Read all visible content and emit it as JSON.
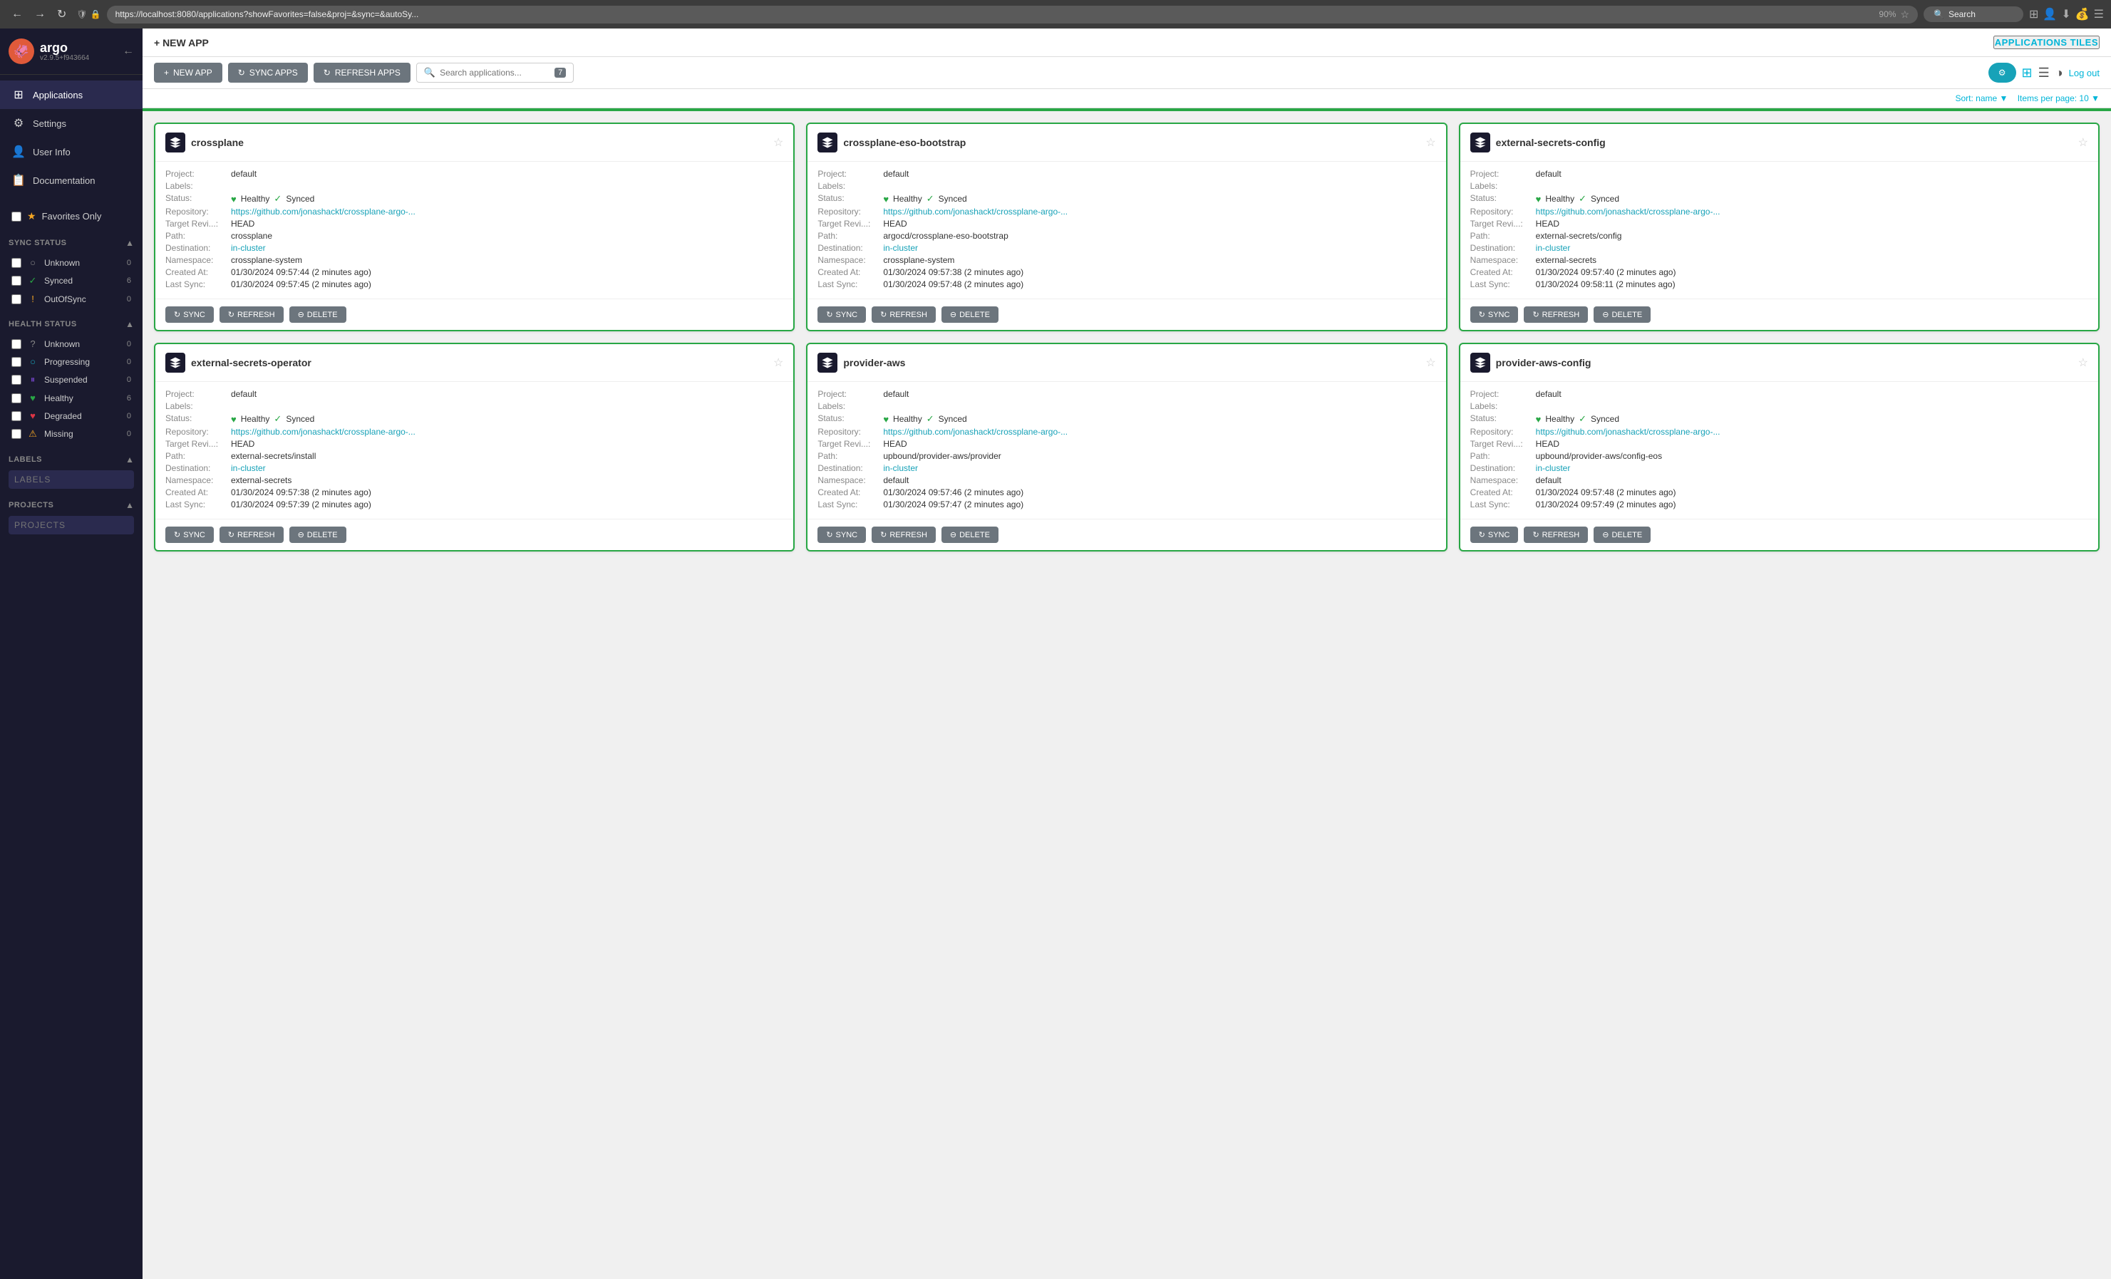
{
  "browser": {
    "url": "https://localhost:8080/applications?showFavorites=false&proj=&sync=&autoSy...",
    "zoom": "90%",
    "search_placeholder": "Search"
  },
  "sidebar": {
    "logo": {
      "name": "argo",
      "version": "v2.9.5+f943664"
    },
    "nav_items": [
      {
        "id": "applications",
        "label": "Applications",
        "icon": "⊞"
      },
      {
        "id": "settings",
        "label": "Settings",
        "icon": "⚙"
      },
      {
        "id": "user-info",
        "label": "User Info",
        "icon": "👤"
      },
      {
        "id": "documentation",
        "label": "Documentation",
        "icon": "📋"
      }
    ],
    "filters": {
      "favorites": {
        "label": "Favorites Only",
        "checked": false
      },
      "sync_status": {
        "title": "SYNC STATUS",
        "items": [
          {
            "id": "unknown",
            "label": "Unknown",
            "icon": "○",
            "color": "#888",
            "count": 0
          },
          {
            "id": "synced",
            "label": "Synced",
            "icon": "✓",
            "color": "#28a745",
            "count": 6
          },
          {
            "id": "out-of-sync",
            "label": "OutOfSync",
            "icon": "!",
            "color": "#f5a623",
            "count": 0
          }
        ]
      },
      "health_status": {
        "title": "HEALTH STATUS",
        "items": [
          {
            "id": "unknown-health",
            "label": "Unknown",
            "icon": "?",
            "color": "#888",
            "count": 0
          },
          {
            "id": "progressing",
            "label": "Progressing",
            "icon": "○",
            "color": "#17a2b8",
            "count": 0
          },
          {
            "id": "suspended",
            "label": "Suspended",
            "icon": "⏸",
            "color": "#6f42c1",
            "count": 0
          },
          {
            "id": "healthy",
            "label": "Healthy",
            "icon": "♥",
            "color": "#28a745",
            "count": 6
          },
          {
            "id": "degraded",
            "label": "Degraded",
            "icon": "♥",
            "color": "#dc3545",
            "count": 0
          },
          {
            "id": "missing",
            "label": "Missing",
            "icon": "⚠",
            "color": "#f5a623",
            "count": 0
          }
        ]
      },
      "labels": {
        "title": "LABELS",
        "placeholder": "LABELS"
      },
      "projects": {
        "title": "PROJECTS",
        "placeholder": "PROJECTS"
      }
    }
  },
  "toolbar": {
    "new_app_label": "+ NEW APP",
    "sync_apps_label": "↻ SYNC APPS",
    "refresh_apps_label": "↻ REFRESH APPS",
    "search_placeholder": "Search applications...",
    "search_count": "7",
    "app_tiles_label": "APPLICATIONS TILES",
    "logout_label": "Log out",
    "sort_label": "Sort: name",
    "items_per_page_label": "Items per page: 10"
  },
  "apps": [
    {
      "id": "crossplane",
      "name": "crossplane",
      "project": "default",
      "labels": "",
      "health": "Healthy",
      "sync": "Synced",
      "repository": "https://github.com/jonashackt/crossplane-argo-...",
      "target_revision": "HEAD",
      "path": "crossplane",
      "destination": "in-cluster",
      "namespace": "crossplane-system",
      "created_at": "01/30/2024 09:57:44 (2 minutes ago)",
      "last_sync": "01/30/2024 09:57:45 (2 minutes ago)"
    },
    {
      "id": "crossplane-eso-bootstrap",
      "name": "crossplane-eso-bootstrap",
      "project": "default",
      "labels": "",
      "health": "Healthy",
      "sync": "Synced",
      "repository": "https://github.com/jonashackt/crossplane-argo-...",
      "target_revision": "HEAD",
      "path": "argocd/crossplane-eso-bootstrap",
      "destination": "in-cluster",
      "namespace": "crossplane-system",
      "created_at": "01/30/2024 09:57:38 (2 minutes ago)",
      "last_sync": "01/30/2024 09:57:48 (2 minutes ago)"
    },
    {
      "id": "external-secrets-config",
      "name": "external-secrets-config",
      "project": "default",
      "labels": "",
      "health": "Healthy",
      "sync": "Synced",
      "repository": "https://github.com/jonashackt/crossplane-argo-...",
      "target_revision": "HEAD",
      "path": "external-secrets/config",
      "destination": "in-cluster",
      "namespace": "external-secrets",
      "created_at": "01/30/2024 09:57:40 (2 minutes ago)",
      "last_sync": "01/30/2024 09:58:11 (2 minutes ago)"
    },
    {
      "id": "external-secrets-operator",
      "name": "external-secrets-operator",
      "project": "default",
      "labels": "",
      "health": "Healthy",
      "sync": "Synced",
      "repository": "https://github.com/jonashackt/crossplane-argo-...",
      "target_revision": "HEAD",
      "path": "external-secrets/install",
      "destination": "in-cluster",
      "namespace": "external-secrets",
      "created_at": "01/30/2024 09:57:38 (2 minutes ago)",
      "last_sync": "01/30/2024 09:57:39 (2 minutes ago)"
    },
    {
      "id": "provider-aws",
      "name": "provider-aws",
      "project": "default",
      "labels": "",
      "health": "Healthy",
      "sync": "Synced",
      "repository": "https://github.com/jonashackt/crossplane-argo-...",
      "target_revision": "HEAD",
      "path": "upbound/provider-aws/provider",
      "destination": "in-cluster",
      "namespace": "default",
      "created_at": "01/30/2024 09:57:46 (2 minutes ago)",
      "last_sync": "01/30/2024 09:57:47 (2 minutes ago)"
    },
    {
      "id": "provider-aws-config",
      "name": "provider-aws-config",
      "project": "default",
      "labels": "",
      "health": "Healthy",
      "sync": "Synced",
      "repository": "https://github.com/jonashackt/crossplane-argo-...",
      "target_revision": "HEAD",
      "path": "upbound/provider-aws/config-eos",
      "destination": "in-cluster",
      "namespace": "default",
      "created_at": "01/30/2024 09:57:48 (2 minutes ago)",
      "last_sync": "01/30/2024 09:57:49 (2 minutes ago)"
    }
  ],
  "labels": {
    "project_label": "Project:",
    "labels_label": "Labels:",
    "status_label": "Status:",
    "repository_label": "Repository:",
    "target_revision_label": "Target Revi...:",
    "path_label": "Path:",
    "destination_label": "Destination:",
    "namespace_label": "Namespace:",
    "created_at_label": "Created At:",
    "last_sync_label": "Last Sync:"
  },
  "actions": {
    "sync": "SYNC",
    "refresh": "REFRESH",
    "delete": "DELETE"
  }
}
